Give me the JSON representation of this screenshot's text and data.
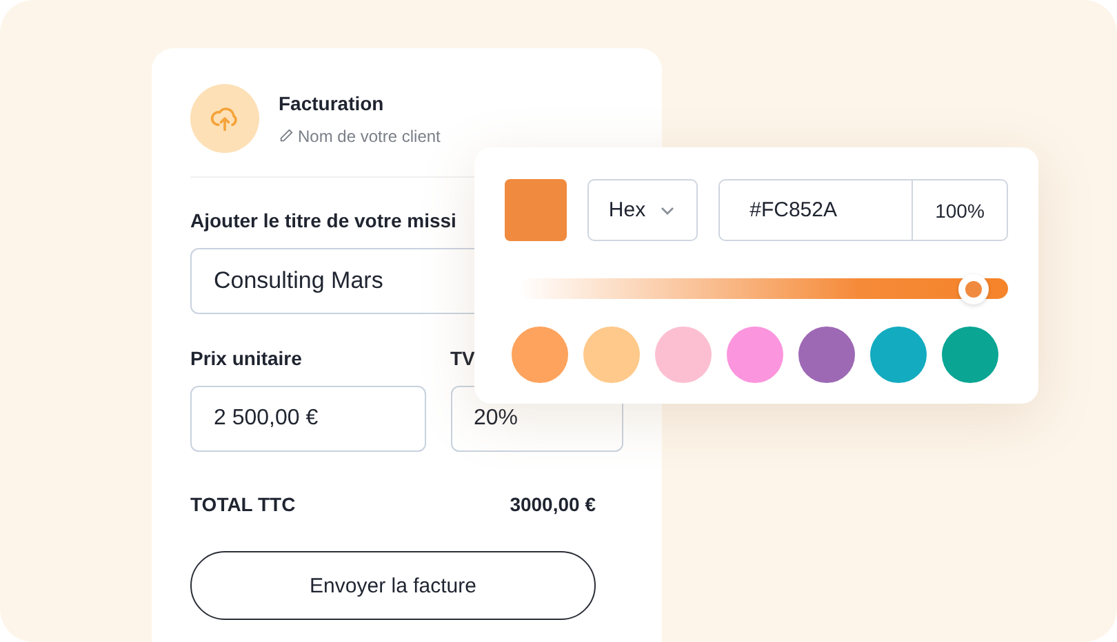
{
  "invoice": {
    "title": "Facturation",
    "client_placeholder": "Nom de votre client",
    "mission_label": "Ajouter le titre de votre missi",
    "mission_value": "Consulting Mars",
    "price_label": "Prix unitaire",
    "price_value": "2 500,00 €",
    "vat_label": "TV",
    "vat_value": "20%",
    "total_label": "TOTAL TTC",
    "total_value": "3000,00 €",
    "submit": "Envoyer la facture"
  },
  "color_picker": {
    "format": "Hex",
    "hex": "#FC852A",
    "opacity": "100%",
    "opacity_slider": {
      "level": 0.93
    },
    "swatches": [
      {
        "color": "#fda35d"
      },
      {
        "color": "#fec98a"
      },
      {
        "color": "#fcbfd2"
      },
      {
        "color": "#fb95dd"
      },
      {
        "color": "#9d69b4"
      },
      {
        "color": "#13abbf"
      },
      {
        "color": "#0aa593"
      }
    ]
  }
}
